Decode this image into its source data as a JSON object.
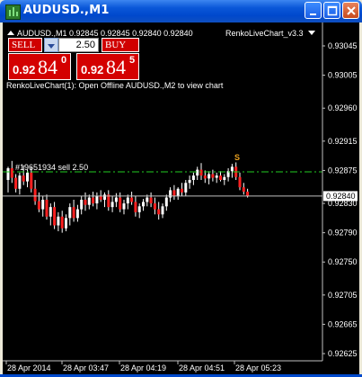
{
  "window": {
    "title": "AUDUSD.,M1"
  },
  "chart": {
    "symbol_info": "AUDUSD.,M1  0.92845 0.92845 0.92840 0.92840",
    "indicator_name": "RenkoLiveChart_v3.3",
    "message": "RenkoLiveChart(1): Open Offline AUDUSD.,M2 to view chart",
    "order_label": "#19651934 sell 2.50",
    "order_price": 0.92873,
    "current_price_label": "0.92840",
    "current_price": 0.9284,
    "sell_marker": "S",
    "y_ticks": [
      "0.93045",
      "0.93005",
      "0.92960",
      "0.92915",
      "0.92875",
      "0.92830",
      "0.92790",
      "0.92750",
      "0.92705",
      "0.92665",
      "0.92625"
    ],
    "x_ticks": [
      "28 Apr 2014",
      "28 Apr 03:47",
      "28 Apr 04:19",
      "28 Apr 04:51",
      "28 Apr 05:23"
    ],
    "colors": {
      "background": "#000000",
      "bull": "#ffffff",
      "bear": "#ff2020",
      "order_line": "#22cc22",
      "price_line": "#c0c0c0",
      "marker": "#e8a020"
    }
  },
  "trade_panel": {
    "sell_label": "SELL",
    "buy_label": "BUY",
    "lot_value": "2.50",
    "sell_price_small": "0.92",
    "sell_price_big": "84",
    "sell_price_sup": "0",
    "buy_price_small": "0.92",
    "buy_price_big": "84",
    "buy_price_sup": "5"
  },
  "chart_data": {
    "type": "candlestick",
    "series": [
      {
        "o": 0.92862,
        "h": 0.9288,
        "l": 0.92845,
        "c": 0.92878
      },
      {
        "o": 0.92878,
        "h": 0.92888,
        "l": 0.92858,
        "c": 0.92865
      },
      {
        "o": 0.92865,
        "h": 0.9287,
        "l": 0.92845,
        "c": 0.9285
      },
      {
        "o": 0.9285,
        "h": 0.92872,
        "l": 0.92842,
        "c": 0.92868
      },
      {
        "o": 0.92868,
        "h": 0.92882,
        "l": 0.92855,
        "c": 0.9286
      },
      {
        "o": 0.9286,
        "h": 0.92876,
        "l": 0.92852,
        "c": 0.92872
      },
      {
        "o": 0.92872,
        "h": 0.9288,
        "l": 0.92845,
        "c": 0.9285
      },
      {
        "o": 0.9285,
        "h": 0.92862,
        "l": 0.92828,
        "c": 0.92833
      },
      {
        "o": 0.92833,
        "h": 0.92845,
        "l": 0.92818,
        "c": 0.92822
      },
      {
        "o": 0.92822,
        "h": 0.9284,
        "l": 0.92812,
        "c": 0.92835
      },
      {
        "o": 0.92835,
        "h": 0.92842,
        "l": 0.92808,
        "c": 0.92812
      },
      {
        "o": 0.92812,
        "h": 0.9283,
        "l": 0.928,
        "c": 0.92825
      },
      {
        "o": 0.92825,
        "h": 0.92832,
        "l": 0.92795,
        "c": 0.928
      },
      {
        "o": 0.928,
        "h": 0.92818,
        "l": 0.92792,
        "c": 0.92812
      },
      {
        "o": 0.92812,
        "h": 0.9282,
        "l": 0.9279,
        "c": 0.92796
      },
      {
        "o": 0.92796,
        "h": 0.92815,
        "l": 0.92792,
        "c": 0.9281
      },
      {
        "o": 0.9281,
        "h": 0.9283,
        "l": 0.928,
        "c": 0.92825
      },
      {
        "o": 0.92825,
        "h": 0.92835,
        "l": 0.92805,
        "c": 0.9281
      },
      {
        "o": 0.9281,
        "h": 0.92828,
        "l": 0.92805,
        "c": 0.92822
      },
      {
        "o": 0.92822,
        "h": 0.9284,
        "l": 0.92815,
        "c": 0.92835
      },
      {
        "o": 0.92835,
        "h": 0.92845,
        "l": 0.9282,
        "c": 0.92828
      },
      {
        "o": 0.92828,
        "h": 0.92842,
        "l": 0.92822,
        "c": 0.92838
      },
      {
        "o": 0.92838,
        "h": 0.92846,
        "l": 0.92826,
        "c": 0.9283
      },
      {
        "o": 0.9283,
        "h": 0.92845,
        "l": 0.92822,
        "c": 0.9284
      },
      {
        "o": 0.9284,
        "h": 0.92848,
        "l": 0.92832,
        "c": 0.92835
      },
      {
        "o": 0.92835,
        "h": 0.92845,
        "l": 0.92825,
        "c": 0.92842
      },
      {
        "o": 0.92842,
        "h": 0.92848,
        "l": 0.9282,
        "c": 0.92825
      },
      {
        "o": 0.92825,
        "h": 0.9284,
        "l": 0.92818,
        "c": 0.92832
      },
      {
        "o": 0.92832,
        "h": 0.92844,
        "l": 0.92825,
        "c": 0.92838
      },
      {
        "o": 0.92838,
        "h": 0.92845,
        "l": 0.92818,
        "c": 0.92822
      },
      {
        "o": 0.92822,
        "h": 0.92835,
        "l": 0.92815,
        "c": 0.9283
      },
      {
        "o": 0.9283,
        "h": 0.92842,
        "l": 0.92822,
        "c": 0.92838
      },
      {
        "o": 0.92838,
        "h": 0.92846,
        "l": 0.92828,
        "c": 0.92832
      },
      {
        "o": 0.92832,
        "h": 0.9284,
        "l": 0.92812,
        "c": 0.92818
      },
      {
        "o": 0.92818,
        "h": 0.9283,
        "l": 0.9281,
        "c": 0.92826
      },
      {
        "o": 0.92826,
        "h": 0.92836,
        "l": 0.9282,
        "c": 0.92832
      },
      {
        "o": 0.92832,
        "h": 0.92842,
        "l": 0.92826,
        "c": 0.92838
      },
      {
        "o": 0.92838,
        "h": 0.92845,
        "l": 0.92825,
        "c": 0.9283
      },
      {
        "o": 0.9283,
        "h": 0.92838,
        "l": 0.92815,
        "c": 0.92822
      },
      {
        "o": 0.92822,
        "h": 0.92832,
        "l": 0.92808,
        "c": 0.92815
      },
      {
        "o": 0.92815,
        "h": 0.9283,
        "l": 0.9281,
        "c": 0.92826
      },
      {
        "o": 0.92826,
        "h": 0.92842,
        "l": 0.9282,
        "c": 0.92838
      },
      {
        "o": 0.92838,
        "h": 0.92852,
        "l": 0.92832,
        "c": 0.92848
      },
      {
        "o": 0.92848,
        "h": 0.92855,
        "l": 0.92835,
        "c": 0.9284
      },
      {
        "o": 0.9284,
        "h": 0.92852,
        "l": 0.92835,
        "c": 0.9285
      },
      {
        "o": 0.9285,
        "h": 0.92858,
        "l": 0.9284,
        "c": 0.92845
      },
      {
        "o": 0.92845,
        "h": 0.92862,
        "l": 0.9284,
        "c": 0.92858
      },
      {
        "o": 0.92858,
        "h": 0.92868,
        "l": 0.9285,
        "c": 0.92862
      },
      {
        "o": 0.92862,
        "h": 0.92872,
        "l": 0.92855,
        "c": 0.92868
      },
      {
        "o": 0.92868,
        "h": 0.9288,
        "l": 0.92862,
        "c": 0.92876
      },
      {
        "o": 0.92876,
        "h": 0.92885,
        "l": 0.92862,
        "c": 0.92868
      },
      {
        "o": 0.92868,
        "h": 0.92875,
        "l": 0.92858,
        "c": 0.92864
      },
      {
        "o": 0.92864,
        "h": 0.92874,
        "l": 0.92856,
        "c": 0.9287
      },
      {
        "o": 0.9287,
        "h": 0.92876,
        "l": 0.9286,
        "c": 0.92865
      },
      {
        "o": 0.92865,
        "h": 0.92872,
        "l": 0.92858,
        "c": 0.92868
      },
      {
        "o": 0.92868,
        "h": 0.92874,
        "l": 0.9286,
        "c": 0.92862
      },
      {
        "o": 0.92862,
        "h": 0.9287,
        "l": 0.92855,
        "c": 0.92866
      },
      {
        "o": 0.92866,
        "h": 0.92878,
        "l": 0.9286,
        "c": 0.92874
      },
      {
        "o": 0.92874,
        "h": 0.92884,
        "l": 0.92865,
        "c": 0.9288
      },
      {
        "o": 0.9288,
        "h": 0.92886,
        "l": 0.92862,
        "c": 0.92866
      },
      {
        "o": 0.92866,
        "h": 0.92872,
        "l": 0.92848,
        "c": 0.92852
      },
      {
        "o": 0.92852,
        "h": 0.92858,
        "l": 0.92842,
        "c": 0.92846
      },
      {
        "o": 0.92846,
        "h": 0.9285,
        "l": 0.92838,
        "c": 0.9284
      }
    ]
  }
}
